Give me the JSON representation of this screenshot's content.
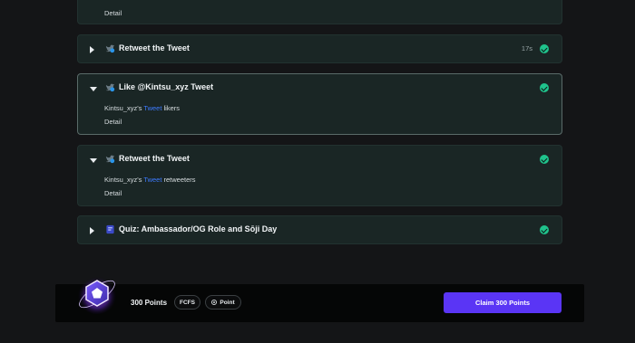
{
  "tasks": [
    {
      "detail_label": "Detail"
    },
    {
      "title": "Retweet the Tweet",
      "time": "17s",
      "icon": "twitter-bird-icon"
    },
    {
      "title": "Like @Kintsu_xyz Tweet",
      "icon": "twitter-bird-icon",
      "desc_prefix": "Kintsu_xyz's",
      "desc_link": "Tweet",
      "desc_suffix": "likers",
      "detail_label": "Detail"
    },
    {
      "title": "Retweet the Tweet",
      "icon": "twitter-bird-icon",
      "desc_prefix": "Kintsu_xyz's",
      "desc_link": "Tweet",
      "desc_suffix": "retweeters",
      "detail_label": "Detail"
    },
    {
      "title": "Quiz: Ambassador/OG Role and Sōji Day",
      "icon": "quiz-icon"
    }
  ],
  "reward": {
    "points_label": "300 Points",
    "tags": [
      "FCFS",
      "Point"
    ],
    "claim_label": "Claim 300 Points"
  },
  "colors": {
    "accent": "#5a35f5",
    "success": "#1fc38c",
    "link": "#3d7bff",
    "card_bg": "#1a2625",
    "page_bg": "#141517"
  }
}
